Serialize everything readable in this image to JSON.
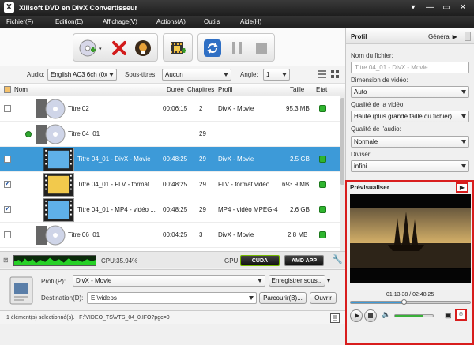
{
  "titlebar": {
    "title": "Xilisoft DVD en DivX Convertisseur",
    "logo": "X"
  },
  "window_controls": [
    "▾",
    "—",
    "▭",
    "✕"
  ],
  "menu": [
    "Fichier(F)",
    "Edition(E)",
    "Affichage(V)",
    "Actions(A)",
    "Outils",
    "Aide(H)"
  ],
  "toolbar": {
    "icons": [
      "add-dvd-icon",
      "delete-icon",
      "clear-icon",
      "add-profile-icon",
      "refresh-icon",
      "pause-icon",
      "stop-icon"
    ]
  },
  "options": {
    "audio_label": "Audio:",
    "audio_value": "English AC3 6ch (0x",
    "subtitles_label": "Sous-titres:",
    "subtitles_value": "Aucun",
    "angle_label": "Angle:",
    "angle_value": "1"
  },
  "table": {
    "headers": {
      "name": "Nom",
      "duration": "Durée",
      "chapters": "Chapitres",
      "profile": "Profil",
      "size": "Taille",
      "status": "Etat"
    },
    "rows": [
      {
        "title": "Titre 02",
        "duration": "00:06:15",
        "chapters": "2",
        "profile": "DivX - Movie",
        "size": "95.3 MB",
        "checked": false,
        "type": "disc"
      },
      {
        "title": "Titre 04_01",
        "duration": "",
        "chapters": "29",
        "profile": "",
        "size": "",
        "checked": false,
        "type": "disc-group"
      },
      {
        "title": "Titre 04_01 - DivX - Movie",
        "duration": "00:48:25",
        "chapters": "29",
        "profile": "DivX - Movie",
        "size": "2.5 GB",
        "checked": false,
        "type": "film",
        "selected": true
      },
      {
        "title": "Titre 04_01 - FLV - format ...",
        "duration": "00:48:25",
        "chapters": "29",
        "profile": "FLV - format vidéo ...",
        "size": "693.9 MB",
        "checked": true,
        "type": "film"
      },
      {
        "title": "Titre 04_01 - MP4 - vidéo ...",
        "duration": "00:48:25",
        "chapters": "29",
        "profile": "MP4 - vidéo MPEG-4",
        "size": "2.6 GB",
        "checked": true,
        "type": "film"
      },
      {
        "title": "Titre 06_01",
        "duration": "00:04:25",
        "chapters": "3",
        "profile": "DivX - Movie",
        "size": "2.8 MB",
        "checked": false,
        "type": "disc"
      }
    ]
  },
  "status": {
    "cpu": "CPU:35.94%",
    "gpu_label": "GPU:",
    "cuda": "CUDA",
    "amd": "AMD APP"
  },
  "profile_area": {
    "profile_label": "Profil(P):",
    "profile_value": "DivX - Movie",
    "save_as": "Enregistrer sous...",
    "dest_label": "Destination(D):",
    "dest_value": "E:\\videos",
    "browse": "Parcourir(B)...",
    "open": "Ouvrir"
  },
  "bottom": {
    "status_text": "1 élément(s) sélectionné(s). | F:\\VIDEO_TS\\VTS_04_0.IFO?pgc=0"
  },
  "right_panel": {
    "profil_title": "Profil",
    "general": "Général ▶",
    "file_name_label": "Nom du fichier:",
    "file_name_placeholder": "Titre 04_01 - DivX - Movie",
    "video_dim_label": "Dimension de vidéo:",
    "video_dim_value": "Auto",
    "video_quality_label": "Qualité de la vidéo:",
    "video_quality_value": "Haute (plus grande taille du fichier)",
    "audio_quality_label": "Qualité de l'audio:",
    "audio_quality_value": "Normale",
    "split_label": "Diviser:",
    "split_value": "infini"
  },
  "preview": {
    "title": "Prévisualiser",
    "time": "01:13:38 / 02:48:25"
  },
  "colors": {
    "accent": "#3d9ad8",
    "highlight_red": "#d81d1d",
    "status_green": "#2fb52f"
  }
}
